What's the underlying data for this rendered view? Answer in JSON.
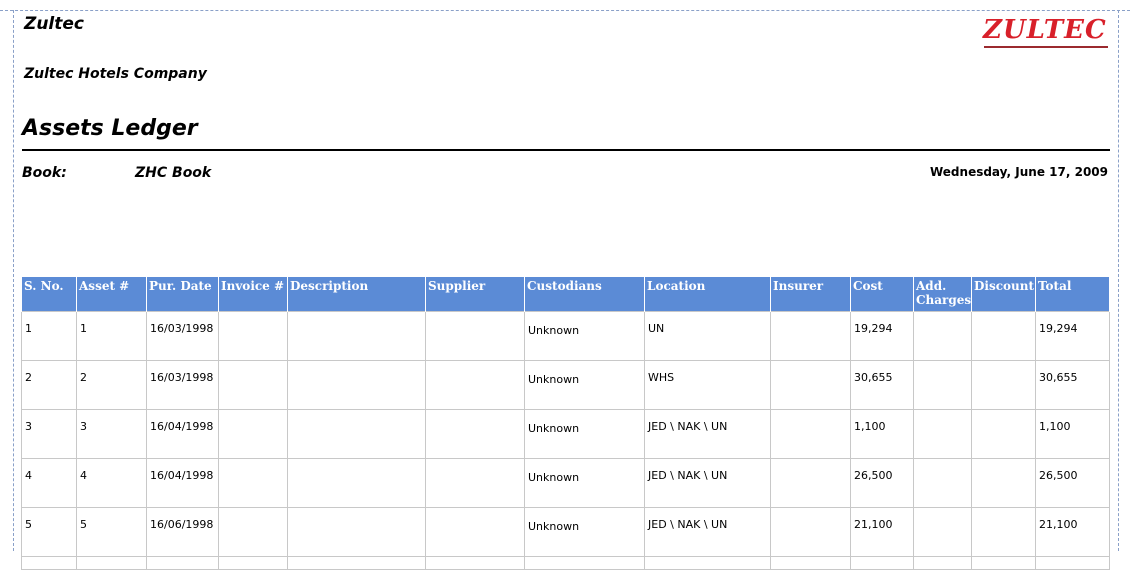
{
  "header": {
    "company_short": "Zultec",
    "company_full": "Zultec Hotels Company",
    "report_title": "Assets Ledger",
    "logo_text": "ZULTEC",
    "book_label": "Book:",
    "book_value": "ZHC Book",
    "date": "Wednesday, June 17, 2009"
  },
  "colors": {
    "header_bg": "#5b8bd6",
    "logo_red": "#d8202a"
  },
  "table": {
    "columns": [
      "S. No.",
      "Asset #",
      "Pur. Date",
      "Invoice #",
      "Description",
      "Supplier",
      "Custodians",
      "Location",
      "Insurer",
      "Cost",
      "Add. Charges",
      "Discount",
      "Total"
    ],
    "rows": [
      {
        "sno": "1",
        "asset": "1",
        "pur_date": "16/03/1998",
        "invoice": "",
        "description": "",
        "supplier": "",
        "custodians": "Unknown",
        "location": "UN",
        "insurer": "",
        "cost": "19,294",
        "add_charges": "",
        "discount": "",
        "total": "19,294"
      },
      {
        "sno": "2",
        "asset": "2",
        "pur_date": "16/03/1998",
        "invoice": "",
        "description": "",
        "supplier": "",
        "custodians": "Unknown",
        "location": "WHS",
        "insurer": "",
        "cost": "30,655",
        "add_charges": "",
        "discount": "",
        "total": "30,655"
      },
      {
        "sno": "3",
        "asset": "3",
        "pur_date": "16/04/1998",
        "invoice": "",
        "description": "",
        "supplier": "",
        "custodians": "Unknown",
        "location": "JED \\ NAK \\ UN",
        "insurer": "",
        "cost": "1,100",
        "add_charges": "",
        "discount": "",
        "total": "1,100"
      },
      {
        "sno": "4",
        "asset": "4",
        "pur_date": "16/04/1998",
        "invoice": "",
        "description": "",
        "supplier": "",
        "custodians": "Unknown",
        "location": "JED \\ NAK \\ UN",
        "insurer": "",
        "cost": "26,500",
        "add_charges": "",
        "discount": "",
        "total": "26,500"
      },
      {
        "sno": "5",
        "asset": "5",
        "pur_date": "16/06/1998",
        "invoice": "",
        "description": "",
        "supplier": "",
        "custodians": "Unknown",
        "location": "JED \\ NAK \\ UN",
        "insurer": "",
        "cost": "21,100",
        "add_charges": "",
        "discount": "",
        "total": "21,100"
      }
    ]
  }
}
